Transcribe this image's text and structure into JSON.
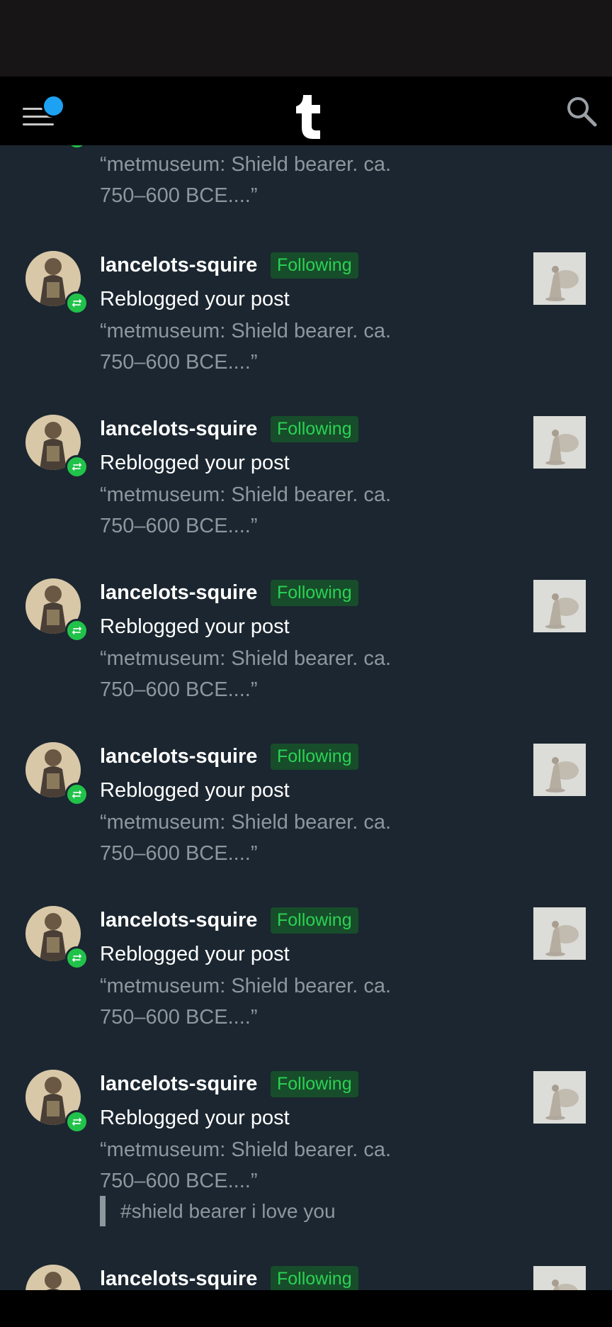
{
  "header": {
    "menu_icon": "hamburger-menu-icon",
    "logo_icon": "tumblr-logo-icon",
    "search_icon": "search-icon",
    "notification_dot_color": "#1da1f2"
  },
  "top_partial": {
    "quote_line1": "“metmuseum: Shield bearer. ca.",
    "quote_line2": "750–600 BCE....”"
  },
  "notifications": [
    {
      "username": "lancelots-squire",
      "status": "Following",
      "action": "Reblogged your post",
      "quote_line1": "“metmuseum: Shield bearer. ca.",
      "quote_line2": "750–600 BCE....”"
    },
    {
      "username": "lancelots-squire",
      "status": "Following",
      "action": "Reblogged your post",
      "quote_line1": "“metmuseum: Shield bearer. ca.",
      "quote_line2": "750–600 BCE....”"
    },
    {
      "username": "lancelots-squire",
      "status": "Following",
      "action": "Reblogged your post",
      "quote_line1": "“metmuseum: Shield bearer. ca.",
      "quote_line2": "750–600 BCE....”"
    },
    {
      "username": "lancelots-squire",
      "status": "Following",
      "action": "Reblogged your post",
      "quote_line1": "“metmuseum: Shield bearer. ca.",
      "quote_line2": "750–600 BCE....”"
    },
    {
      "username": "lancelots-squire",
      "status": "Following",
      "action": "Reblogged your post",
      "quote_line1": "“metmuseum: Shield bearer. ca.",
      "quote_line2": "750–600 BCE....”"
    },
    {
      "username": "lancelots-squire",
      "status": "Following",
      "action": "Reblogged your post",
      "quote_line1": "“metmuseum: Shield bearer. ca.",
      "quote_line2": "750–600 BCE....”",
      "tag": "#shield bearer i love you"
    },
    {
      "username": "lancelots-squire",
      "status": "Following"
    }
  ],
  "colors": {
    "background": "#1b2630",
    "accent_green": "#2bd254",
    "following_bg": "#174d2a",
    "muted_text": "#8e979e"
  }
}
